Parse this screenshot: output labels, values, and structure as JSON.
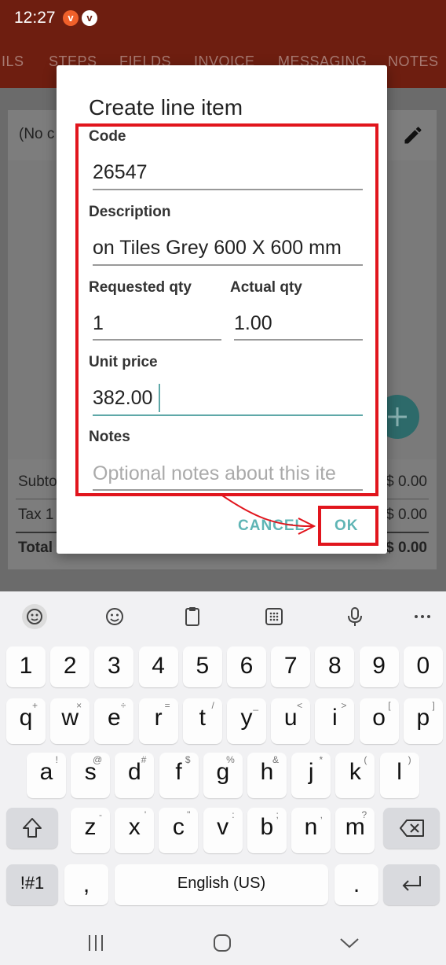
{
  "status_bar": {
    "time": "12:27",
    "badge1": "v",
    "badge2": "v"
  },
  "tabs": [
    "ILS",
    "STEPS",
    "FIELDS",
    "INVOICE",
    "MESSAGING",
    "NOTES"
  ],
  "background": {
    "no_code": "(No c",
    "subtotal_label": "Subto",
    "subtotal_value": "$ 0.00",
    "tax_label": "Tax 1",
    "tax_value": "$ 0.00",
    "total_label": "Total",
    "total_value": "$ 0.00"
  },
  "dialog": {
    "title": "Create line item",
    "code_label": "Code",
    "code_value": "26547",
    "description_label": "Description",
    "description_value": "on Tiles Grey 600 X 600 mm",
    "requested_qty_label": "Requested qty",
    "requested_qty_value": "1",
    "actual_qty_label": "Actual qty",
    "actual_qty_value": "1.00",
    "unit_price_label": "Unit price",
    "unit_price_value": "382.00",
    "notes_label": "Notes",
    "notes_placeholder": "Optional notes about this ite",
    "cancel_label": "CANCEL",
    "ok_label": "OK"
  },
  "keyboard": {
    "toolbar_icons": [
      "emoji-panel-icon",
      "emoji-icon",
      "clipboard-icon",
      "keypad-icon",
      "mic-icon",
      "more-icon"
    ],
    "row_numbers": [
      "1",
      "2",
      "3",
      "4",
      "5",
      "6",
      "7",
      "8",
      "9",
      "0"
    ],
    "row_top": [
      {
        "k": "q",
        "s": "+"
      },
      {
        "k": "w",
        "s": "×"
      },
      {
        "k": "e",
        "s": "÷"
      },
      {
        "k": "r",
        "s": "="
      },
      {
        "k": "t",
        "s": "/"
      },
      {
        "k": "y",
        "s": "_"
      },
      {
        "k": "u",
        "s": "<"
      },
      {
        "k": "i",
        "s": ">"
      },
      {
        "k": "o",
        "s": "["
      },
      {
        "k": "p",
        "s": "]"
      }
    ],
    "row_mid": [
      {
        "k": "a",
        "s": "!"
      },
      {
        "k": "s",
        "s": "@"
      },
      {
        "k": "d",
        "s": "#"
      },
      {
        "k": "f",
        "s": "$"
      },
      {
        "k": "g",
        "s": "%"
      },
      {
        "k": "h",
        "s": "&"
      },
      {
        "k": "j",
        "s": "*"
      },
      {
        "k": "k",
        "s": "("
      },
      {
        "k": "l",
        "s": ")"
      }
    ],
    "row_bottom": [
      {
        "k": "z",
        "s": "-"
      },
      {
        "k": "x",
        "s": "'"
      },
      {
        "k": "c",
        "s": "\""
      },
      {
        "k": "v",
        "s": ":"
      },
      {
        "k": "b",
        "s": ";"
      },
      {
        "k": "n",
        "s": ","
      },
      {
        "k": "m",
        "s": "?"
      }
    ],
    "symbols_label": "!#1",
    "comma_label": ",",
    "space_label": "English (US)",
    "period_label": "."
  }
}
